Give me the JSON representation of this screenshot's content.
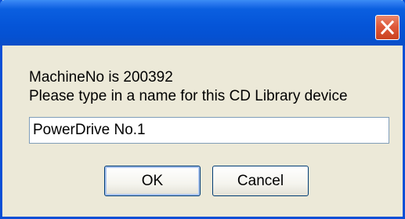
{
  "dialog": {
    "title": "",
    "message_line1": "MachineNo is 200392",
    "message_line2": "Please type in a name for this CD Library device",
    "name_value": "PowerDrive No.1",
    "ok_label": "OK",
    "cancel_label": "Cancel"
  },
  "icons": {
    "close": "close-icon"
  },
  "colors": {
    "titlebar": "#0555d8",
    "window_face": "#ece9d8",
    "close_button": "#df5a3b",
    "input_border": "#7f9db9",
    "button_border": "#003c74"
  }
}
